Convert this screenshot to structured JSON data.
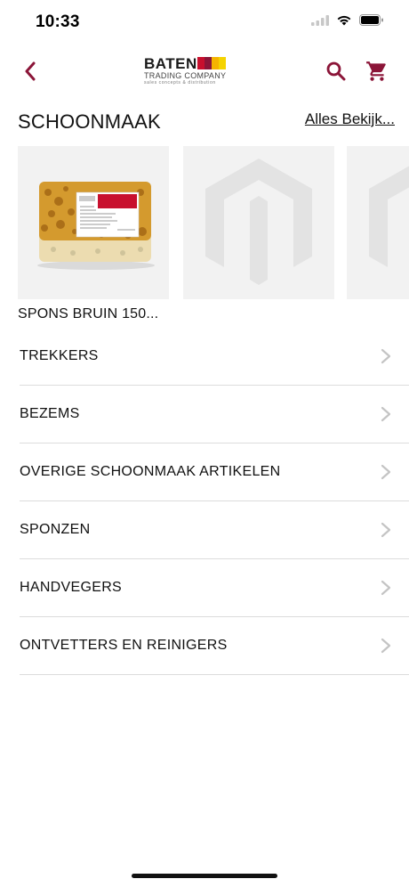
{
  "status_bar": {
    "time": "10:33"
  },
  "header": {
    "logo": {
      "word": "BATEN",
      "sub": "TRADING COMPANY",
      "tag": "sales concepts & distribution"
    },
    "accent_color": "#8b1538"
  },
  "section": {
    "title": "SCHOONMAAK",
    "see_all_label": "Alles Bekijk..."
  },
  "products": [
    {
      "name": "SPONS BRUIN 150...",
      "image": "sponge"
    },
    {
      "name": "",
      "image": "placeholder"
    },
    {
      "name": "",
      "image": "placeholder"
    }
  ],
  "categories": [
    {
      "label": "TREKKERS"
    },
    {
      "label": "BEZEMS"
    },
    {
      "label": "OVERIGE SCHOONMAAK ARTIKELEN"
    },
    {
      "label": "SPONZEN"
    },
    {
      "label": "HANDVEGERS"
    },
    {
      "label": "ONTVETTERS EN REINIGERS"
    }
  ]
}
